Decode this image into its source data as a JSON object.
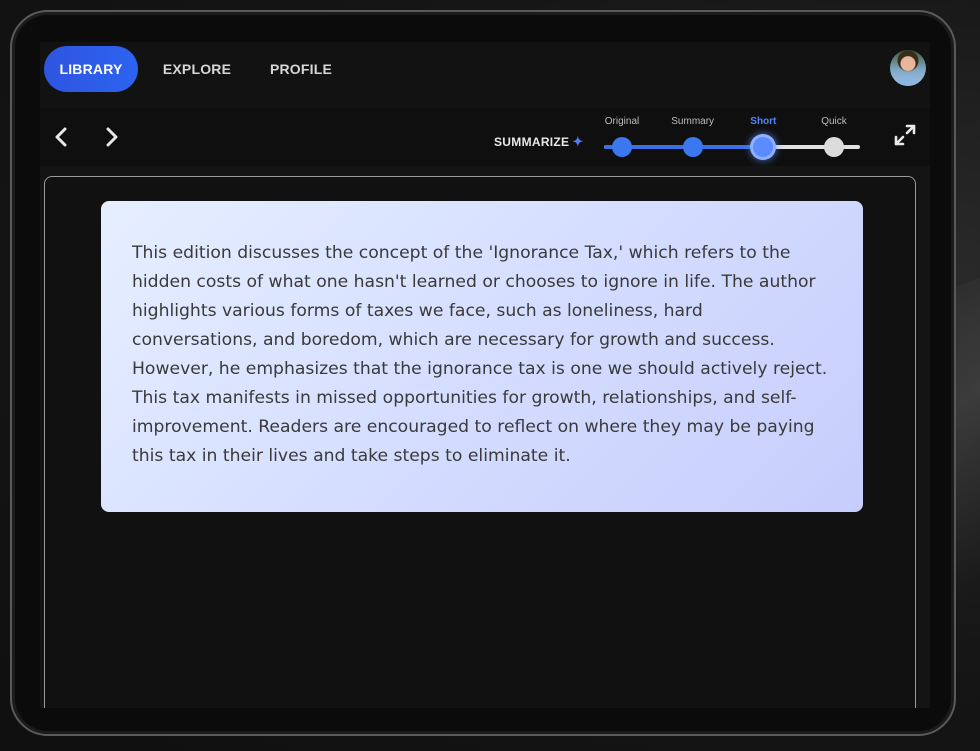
{
  "nav": {
    "tabs": [
      {
        "label": "LIBRARY",
        "active": true
      },
      {
        "label": "EXPLORE",
        "active": false
      },
      {
        "label": "PROFILE",
        "active": false
      }
    ]
  },
  "toolbar": {
    "summarize_label": "SUMMARIZE",
    "summarize_icon": "sparkle-icon",
    "back_icon": "chevron-left-icon",
    "forward_icon": "chevron-right-icon",
    "expand_icon": "expand-icon"
  },
  "slider": {
    "steps": [
      "Original",
      "Summary",
      "Short",
      "Quick"
    ],
    "selected_index": 2,
    "accent_color": "#3b6fe8"
  },
  "content": {
    "summary_text": "This edition discusses the concept of the 'Ignorance Tax,' which refers to the hidden costs of what one hasn't learned or chooses to ignore in life. The author highlights various forms of taxes we face, such as loneliness, hard conversations, and boredom, which are necessary for growth and success. However, he emphasizes that the ignorance tax is one we should actively reject. This tax manifests in missed opportunities for growth, relationships, and self-improvement. Readers are encouraged to reflect on where they may be paying this tax in their lives and take steps to eliminate it."
  },
  "colors": {
    "active_tab": "#2f55e0",
    "card_gradient_start": "#e6efff",
    "card_gradient_end": "#c7cdfb",
    "background": "#141414"
  }
}
